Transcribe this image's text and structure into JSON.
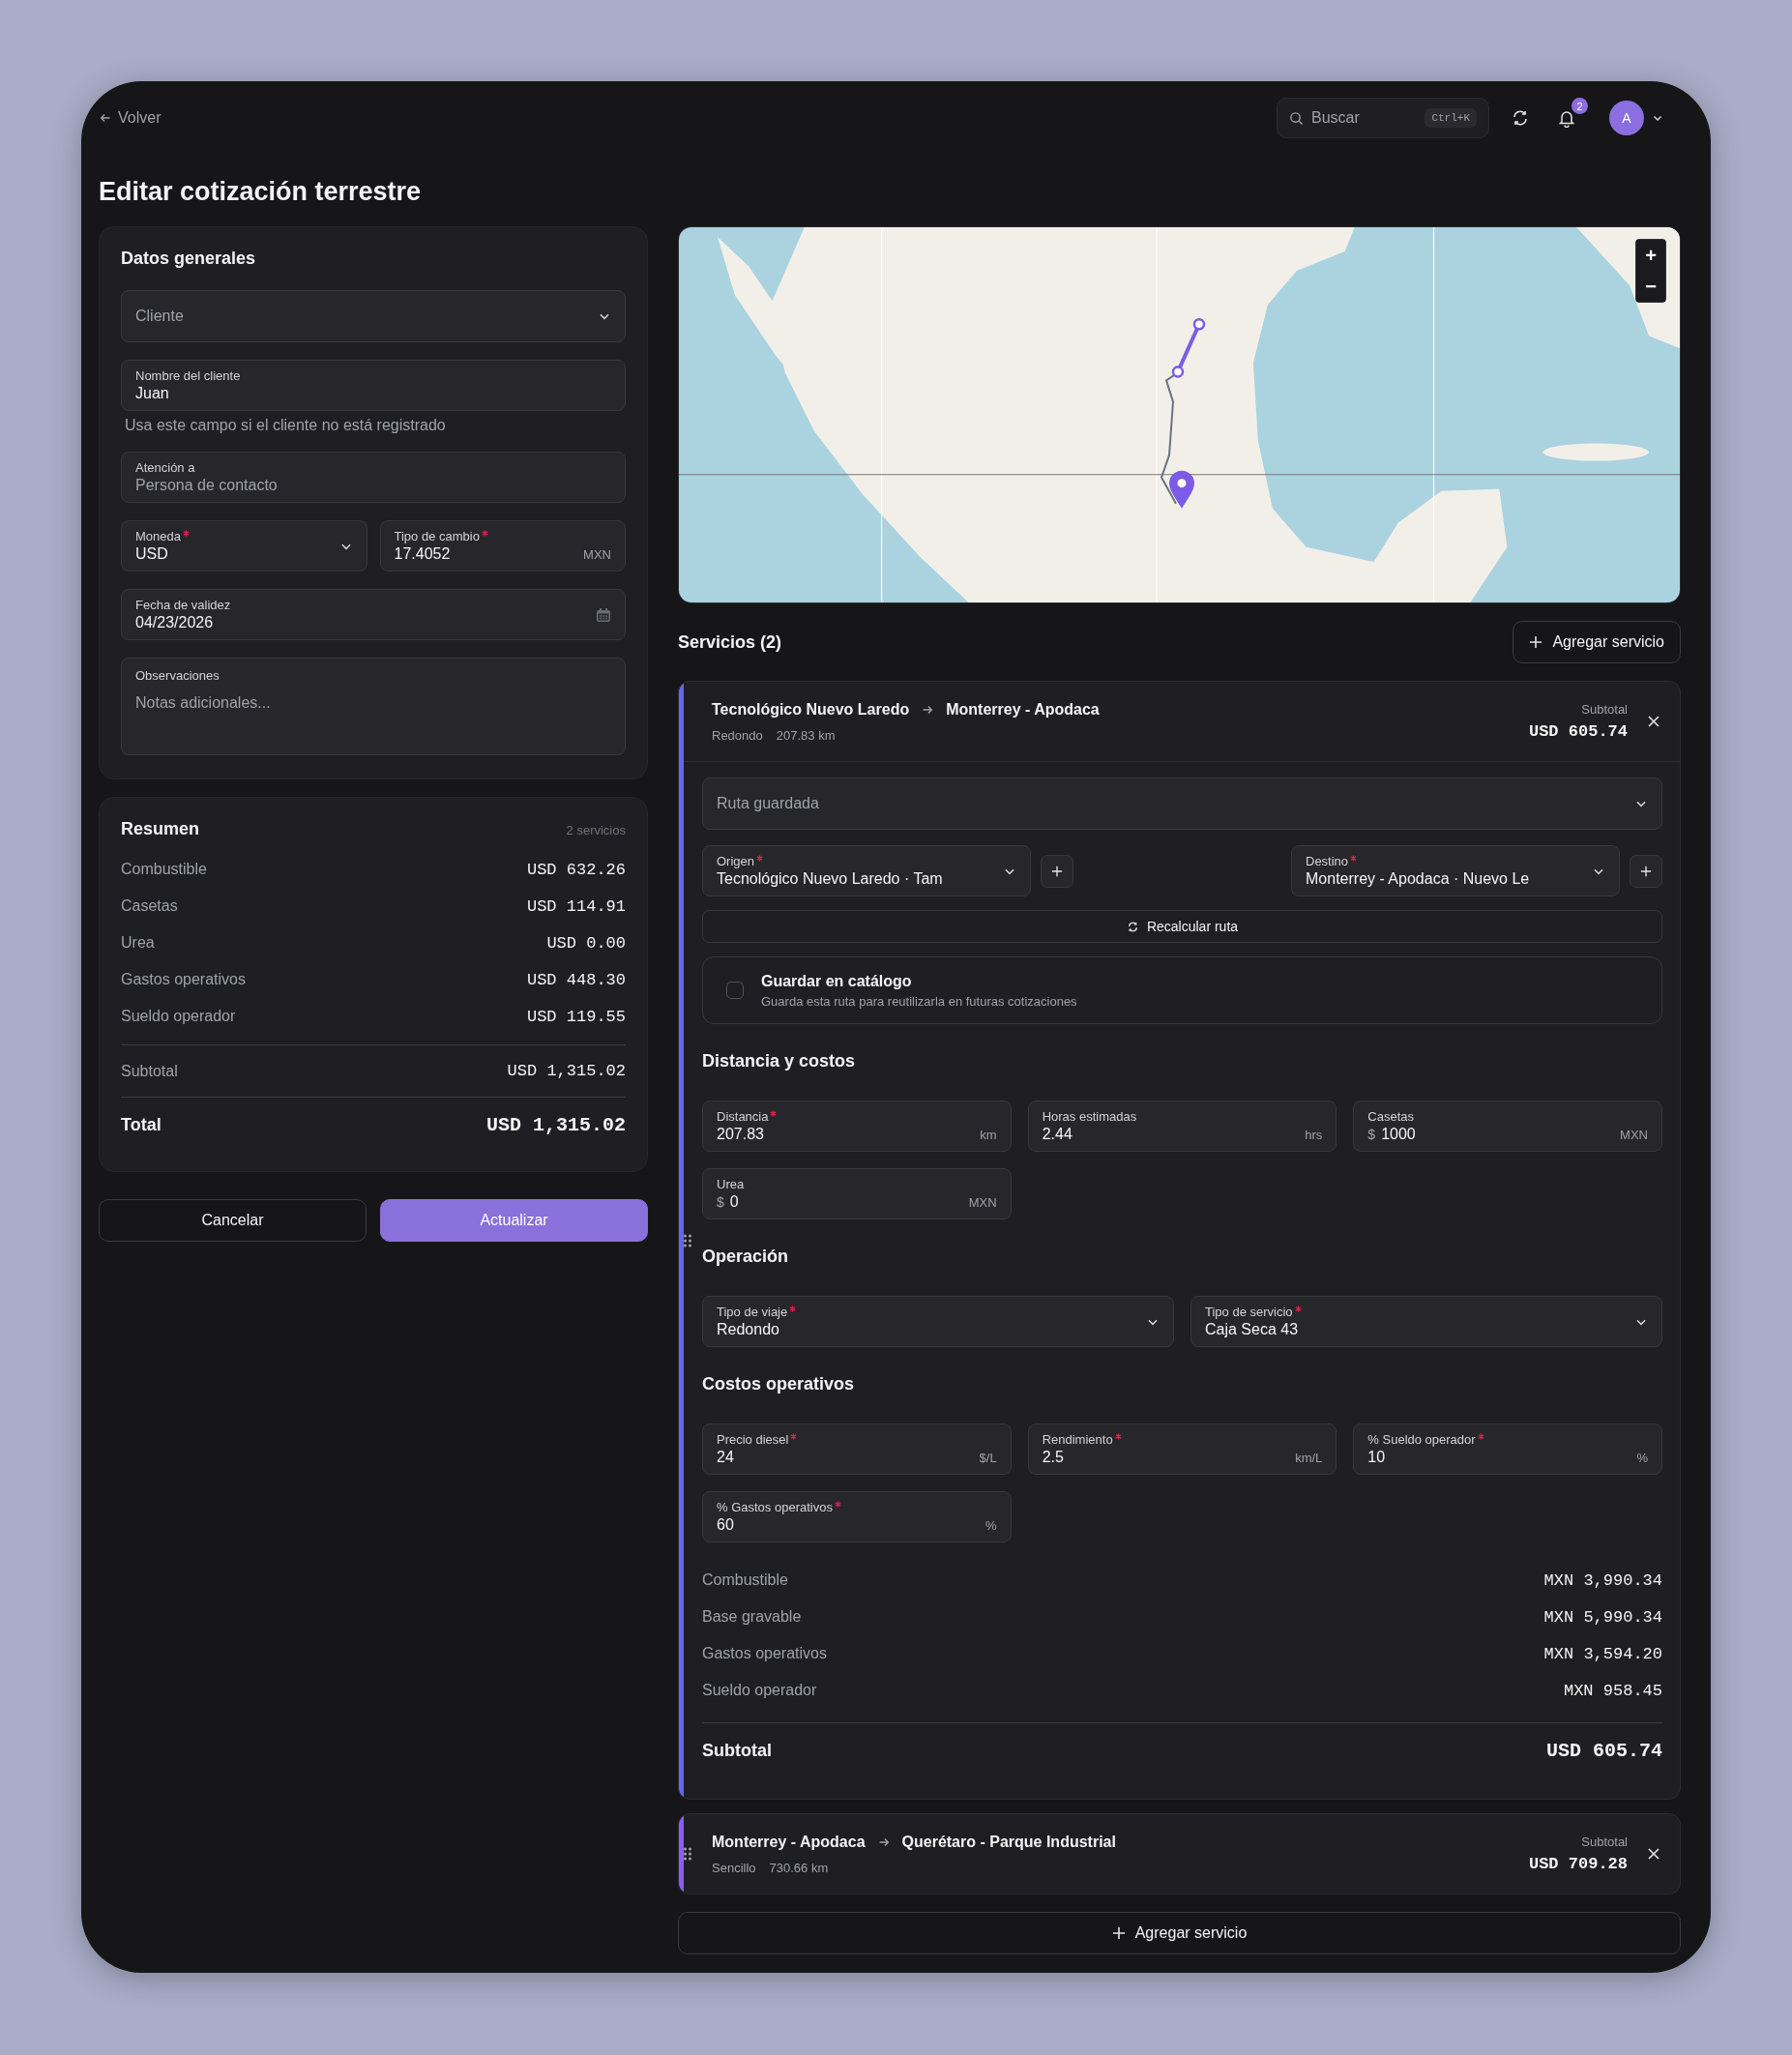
{
  "topbar": {
    "back": "Volver",
    "search": {
      "placeholder": "Buscar",
      "shortcut": "Ctrl+K"
    },
    "notifications": "2",
    "avatar": "A"
  },
  "title": "Editar cotización terrestre",
  "general": {
    "title": "Datos generales",
    "rows": [
      [
        {
          "kind": "select",
          "placeholder": "Cliente"
        }
      ],
      [
        {
          "kind": "input",
          "label": "Nombre del cliente",
          "value": "Juan",
          "hint": "Usa este campo si el cliente no está registrado"
        }
      ],
      [
        {
          "kind": "input",
          "label": "Atención a",
          "placeholder": "Persona de contacto"
        }
      ],
      [
        {
          "kind": "select",
          "label": "Moneda",
          "required": true,
          "value": "USD"
        },
        {
          "kind": "input",
          "label": "Tipo de cambio",
          "required": true,
          "value": "17.4052",
          "suffix": "MXN"
        }
      ],
      [
        {
          "kind": "date",
          "label": "Fecha de validez",
          "value": "04/23/2026"
        }
      ],
      [
        {
          "kind": "textarea",
          "label": "Observaciones",
          "placeholder": "Notas adicionales..."
        }
      ]
    ]
  },
  "summary": {
    "title": "Resumen",
    "count": "2 servicios",
    "lines": [
      {
        "label": "Combustible",
        "value": "USD 632.26"
      },
      {
        "label": "Casetas",
        "value": "USD 114.91"
      },
      {
        "label": "Urea",
        "value": "USD 0.00"
      },
      {
        "label": "Gastos operativos",
        "value": "USD 448.30"
      },
      {
        "label": "Sueldo operador",
        "value": "USD 119.55"
      }
    ],
    "subtotal": {
      "label": "Subtotal",
      "value": "USD 1,315.02"
    },
    "total": {
      "label": "Total",
      "value": "USD 1,315.02"
    }
  },
  "actions": [
    {
      "kind": "secondary",
      "label": "Cancelar"
    },
    {
      "kind": "primary",
      "label": "Actualizar"
    }
  ],
  "map": {
    "zoom_in": "+",
    "zoom_out": "−"
  },
  "services": {
    "title": "Servicios (2)",
    "add_label": "Agregar servicio",
    "items": [
      {
        "from": "Tecnológico Nuevo Laredo",
        "to": "Monterrey - Apodaca",
        "trip": "Redondo",
        "distance": "207.83 km",
        "subtotal_label": "Subtotal",
        "subtotal": "USD 605.74",
        "color": "#6366f1",
        "expanded": true,
        "saved_route": {
          "placeholder": "Ruta guardada"
        },
        "origin": {
          "label": "Origen",
          "required": true,
          "value": "Tecnológico Nuevo Laredo · Tam"
        },
        "destination": {
          "label": "Destino",
          "required": true,
          "value": "Monterrey - Apodaca · Nuevo Le"
        },
        "recalc": "Recalcular ruta",
        "catalog": {
          "title": "Guardar en catálogo",
          "description": "Guarda esta ruta para reutilizarla en futuras cotizaciones",
          "checked": false
        },
        "sections": [
          {
            "title": "Distancia y costos",
            "fields": [
              {
                "kind": "input",
                "label": "Distancia",
                "required": true,
                "value": "207.83",
                "suffix": "km"
              },
              {
                "kind": "input",
                "label": "Horas estimadas",
                "value": "2.44",
                "suffix": "hrs"
              },
              {
                "kind": "input",
                "label": "Casetas",
                "prefix": "$",
                "value": "1000",
                "suffix": "MXN"
              },
              {
                "kind": "input",
                "label": "Urea",
                "prefix": "$",
                "value": "0",
                "suffix": "MXN"
              }
            ]
          },
          {
            "title": "Operación",
            "fields": [
              {
                "kind": "select",
                "label": "Tipo de viaje",
                "required": true,
                "value": "Redondo"
              },
              {
                "kind": "select",
                "label": "Tipo de servicio",
                "required": true,
                "value": "Caja Seca 43"
              }
            ]
          },
          {
            "title": "Costos operativos",
            "fields": [
              {
                "kind": "input",
                "label": "Precio diesel",
                "required": true,
                "value": "24",
                "suffix": "$/L"
              },
              {
                "kind": "input",
                "label": "Rendimiento",
                "required": true,
                "value": "2.5",
                "suffix": "km/L"
              },
              {
                "kind": "input",
                "label": "% Sueldo operador",
                "required": true,
                "value": "10",
                "suffix": "%"
              },
              {
                "kind": "input",
                "label": "% Gastos operativos",
                "required": true,
                "value": "60",
                "suffix": "%"
              }
            ]
          }
        ],
        "costs": [
          {
            "label": "Combustible",
            "value": "MXN 3,990.34"
          },
          {
            "label": "Base gravable",
            "value": "MXN 5,990.34"
          },
          {
            "label": "Gastos operativos",
            "value": "MXN 3,594.20"
          },
          {
            "label": "Sueldo operador",
            "value": "MXN 958.45"
          }
        ],
        "total": {
          "label": "Subtotal",
          "value": "USD 605.74"
        }
      },
      {
        "from": "Monterrey - Apodaca",
        "to": "Querétaro - Parque Industrial",
        "trip": "Sencillo",
        "distance": "730.66 km",
        "subtotal_label": "Subtotal",
        "subtotal": "USD 709.28",
        "color": "#8b5cf6",
        "expanded": false
      }
    ],
    "add_bottom": "Agregar servicio"
  }
}
